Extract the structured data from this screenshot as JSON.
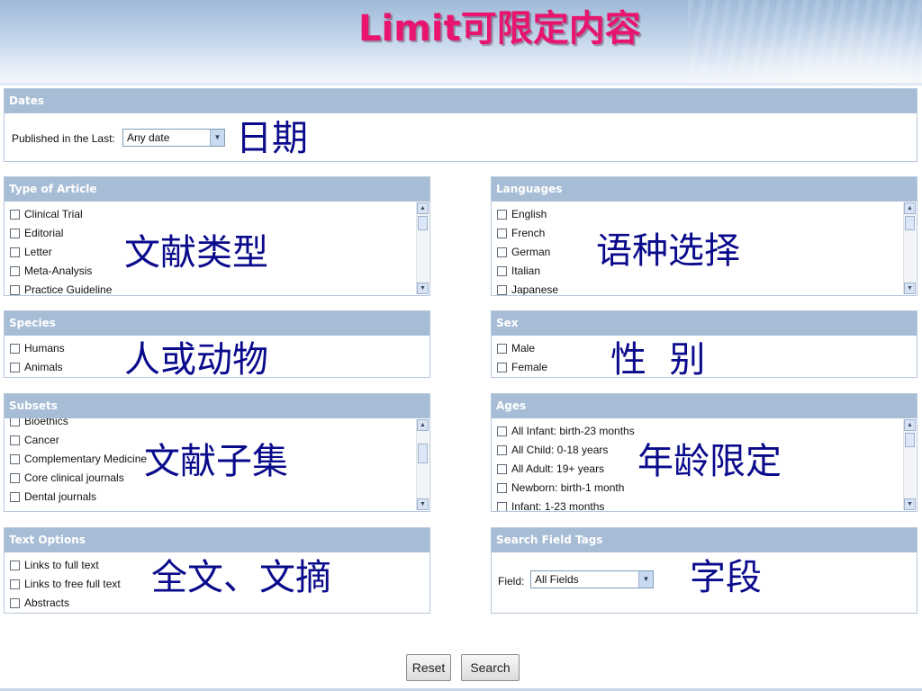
{
  "slide": {
    "title": "Limit可限定内容"
  },
  "dates": {
    "header": "Dates",
    "published_label": "Published in the Last:",
    "published_value": "Any date",
    "annotation": "日期"
  },
  "type_of_article": {
    "header": "Type of Article",
    "items": [
      "Clinical Trial",
      "Editorial",
      "Letter",
      "Meta-Analysis",
      "Practice Guideline"
    ],
    "annotation": "文献类型"
  },
  "languages": {
    "header": "Languages",
    "items": [
      "English",
      "French",
      "German",
      "Italian",
      "Japanese"
    ],
    "annotation": "语种选择"
  },
  "species": {
    "header": "Species",
    "items": [
      "Humans",
      "Animals"
    ],
    "annotation": "人或动物"
  },
  "sex": {
    "header": "Sex",
    "items": [
      "Male",
      "Female"
    ],
    "annotation": "性  别"
  },
  "subsets": {
    "header": "Subsets",
    "items": [
      "Bioethics",
      "Cancer",
      "Complementary Medicine",
      "Core clinical journals",
      "Dental journals"
    ],
    "annotation": "文献子集"
  },
  "ages": {
    "header": "Ages",
    "items": [
      "All Infant: birth-23 months",
      "All Child: 0-18 years",
      "All Adult: 19+ years",
      "Newborn: birth-1 month",
      "Infant: 1-23 months"
    ],
    "annotation": "年龄限定"
  },
  "text_options": {
    "header": "Text Options",
    "items": [
      "Links to full text",
      "Links to free full text",
      "Abstracts"
    ],
    "annotation": "全文、文摘"
  },
  "search_field_tags": {
    "header": "Search Field Tags",
    "field_label": "Field:",
    "field_value": "All Fields",
    "annotation": "字段"
  },
  "buttons": {
    "reset_label": "Reset",
    "search_label": "Search"
  },
  "icons": {
    "checkbox": "checkbox-icon",
    "dropdown": "chevron-down-icon",
    "scroll_up": "scroll-up-icon",
    "scroll_down": "scroll-down-icon"
  },
  "colors": {
    "title": "#e8146e",
    "panel_header": "#a7bdd6",
    "annotation": "#0a0a8c"
  }
}
